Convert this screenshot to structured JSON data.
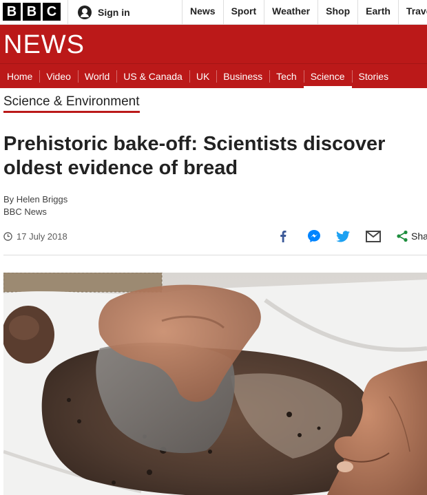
{
  "bbc_logo": {
    "letters": [
      "B",
      "B",
      "C"
    ]
  },
  "account": {
    "sign_in_label": "Sign in",
    "icon": "user-icon"
  },
  "top_nav": {
    "items": [
      "News",
      "Sport",
      "Weather",
      "Shop",
      "Earth",
      "Trave"
    ]
  },
  "brand": {
    "title": "NEWS",
    "color": "#bb1919"
  },
  "section_nav": {
    "items": [
      "Home",
      "Video",
      "World",
      "US & Canada",
      "UK",
      "Business",
      "Tech",
      "Science",
      "Stories"
    ],
    "active": "Science"
  },
  "article": {
    "section_label": "Science & Environment",
    "headline": "Prehistoric bake-off: Scientists discover oldest evidence of bread",
    "byline_author": "By Helen Briggs",
    "byline_org": "BBC News",
    "date": "17 July 2018",
    "share_label": "Sha",
    "share_icons": [
      "facebook-icon",
      "messenger-icon",
      "twitter-icon",
      "email-icon",
      "share-icon"
    ]
  }
}
